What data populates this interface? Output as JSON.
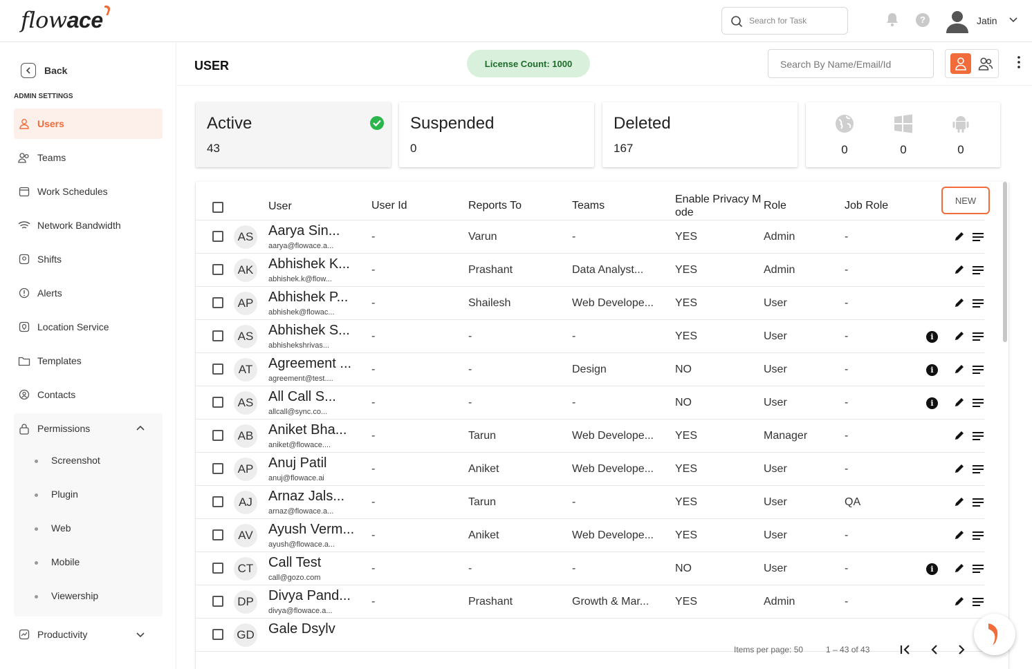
{
  "app": {
    "logo_light": "flow",
    "logo_bold": "ace",
    "brand_color": "#f26b3a"
  },
  "topbar": {
    "task_search_placeholder": "Search for Task",
    "user_name": "Jatin",
    "help": "?"
  },
  "sidebar": {
    "back_label": "Back",
    "section_label": "ADMIN SETTINGS",
    "items": [
      {
        "label": "Users",
        "icon": "user-icon",
        "active": true
      },
      {
        "label": "Teams",
        "icon": "teams-icon"
      },
      {
        "label": "Work Schedules",
        "icon": "calendar-icon"
      },
      {
        "label": "Network Bandwidth",
        "icon": "wifi-icon"
      },
      {
        "label": "Shifts",
        "icon": "shift-icon"
      },
      {
        "label": "Alerts",
        "icon": "alert-icon"
      },
      {
        "label": "Location Service",
        "icon": "location-icon"
      },
      {
        "label": "Templates",
        "icon": "folder-icon"
      },
      {
        "label": "Contacts",
        "icon": "contact-icon"
      },
      {
        "label": "Permissions",
        "icon": "lock-icon"
      }
    ],
    "permission_sub": [
      "Screenshot",
      "Plugin",
      "Web",
      "Mobile",
      "Viewership"
    ],
    "productivity_label": "Productivity"
  },
  "header": {
    "title": "USER",
    "license": "License Count: 1000",
    "search_placeholder": "Search By Name/Email/Id"
  },
  "stats": {
    "active": {
      "label": "Active",
      "value": "43"
    },
    "suspended": {
      "label": "Suspended",
      "value": "0"
    },
    "deleted": {
      "label": "Deleted",
      "value": "167"
    },
    "devices": {
      "web": "0",
      "windows": "0",
      "android": "0"
    }
  },
  "table": {
    "columns": {
      "user": "User",
      "user_id": "User Id",
      "reports_to": "Reports To",
      "teams": "Teams",
      "privacy_1": "Enable Privacy M",
      "privacy_2": "ode",
      "role": "Role",
      "job_role": "Job Role",
      "new_btn": "NEW"
    },
    "rows": [
      {
        "initials": "AS",
        "name": "Aarya Sin...",
        "email": "aarya@flowace.a...",
        "user_id": "-",
        "reports_to": "Varun",
        "teams": "-",
        "privacy": "YES",
        "role": "Admin",
        "job_role": "-",
        "info": false
      },
      {
        "initials": "AK",
        "name": "Abhishek K...",
        "email": "abhishek.k@flow...",
        "user_id": "-",
        "reports_to": "Prashant",
        "teams": "Data Analyst...",
        "privacy": "YES",
        "role": "Admin",
        "job_role": "-",
        "info": false
      },
      {
        "initials": "AP",
        "name": "Abhishek P...",
        "email": "abhishek@flowac...",
        "user_id": "-",
        "reports_to": "Shailesh",
        "teams": "Web Develope...",
        "privacy": "YES",
        "role": "User",
        "job_role": "-",
        "info": false
      },
      {
        "initials": "AS",
        "name": "Abhishek S...",
        "email": "abhishekshrivas...",
        "user_id": "-",
        "reports_to": "-",
        "teams": "-",
        "privacy": "YES",
        "role": "User",
        "job_role": "-",
        "info": true
      },
      {
        "initials": "AT",
        "name": "Agreement ...",
        "email": "agreement@test....",
        "user_id": "-",
        "reports_to": "-",
        "teams": "Design",
        "privacy": "NO",
        "role": "User",
        "job_role": "-",
        "info": true
      },
      {
        "initials": "AS",
        "name": "All Call S...",
        "email": "allcall@sync.co...",
        "user_id": "-",
        "reports_to": "-",
        "teams": "-",
        "privacy": "NO",
        "role": "User",
        "job_role": "-",
        "info": true
      },
      {
        "initials": "AB",
        "name": "Aniket Bha...",
        "email": "aniket@flowace....",
        "user_id": "-",
        "reports_to": "Tarun",
        "teams": "Web Develope...",
        "privacy": "YES",
        "role": "Manager",
        "job_role": "-",
        "info": false
      },
      {
        "initials": "AP",
        "name": "Anuj Patil",
        "email": "anuj@flowace.ai",
        "user_id": "-",
        "reports_to": "Aniket",
        "teams": "Web Develope...",
        "privacy": "YES",
        "role": "User",
        "job_role": "-",
        "info": false
      },
      {
        "initials": "AJ",
        "name": "Arnaz Jals...",
        "email": "arnaz@flowace.a...",
        "user_id": "-",
        "reports_to": "Tarun",
        "teams": "-",
        "privacy": "YES",
        "role": "User",
        "job_role": "QA",
        "info": false
      },
      {
        "initials": "AV",
        "name": "Ayush Verm...",
        "email": "ayush@flowace.a...",
        "user_id": "-",
        "reports_to": "Aniket",
        "teams": "Web Develope...",
        "privacy": "YES",
        "role": "User",
        "job_role": "-",
        "info": false
      },
      {
        "initials": "CT",
        "name": "Call Test",
        "email": "call@gozo.com",
        "user_id": "-",
        "reports_to": "-",
        "teams": "-",
        "privacy": "NO",
        "role": "User",
        "job_role": "-",
        "info": true
      },
      {
        "initials": "DP",
        "name": "Divya Pand...",
        "email": "divya@flowace.a...",
        "user_id": "-",
        "reports_to": "Prashant",
        "teams": "Growth & Mar...",
        "privacy": "YES",
        "role": "Admin",
        "job_role": "-",
        "info": false
      },
      {
        "initials": "GD",
        "name": "Gale Dsylv",
        "email": "",
        "user_id": "",
        "reports_to": "",
        "teams": "",
        "privacy": "",
        "role": "",
        "job_role": "",
        "info": false
      }
    ]
  },
  "pager": {
    "items_per_page": "Items per page: 50",
    "range": "1 – 43 of 43"
  }
}
